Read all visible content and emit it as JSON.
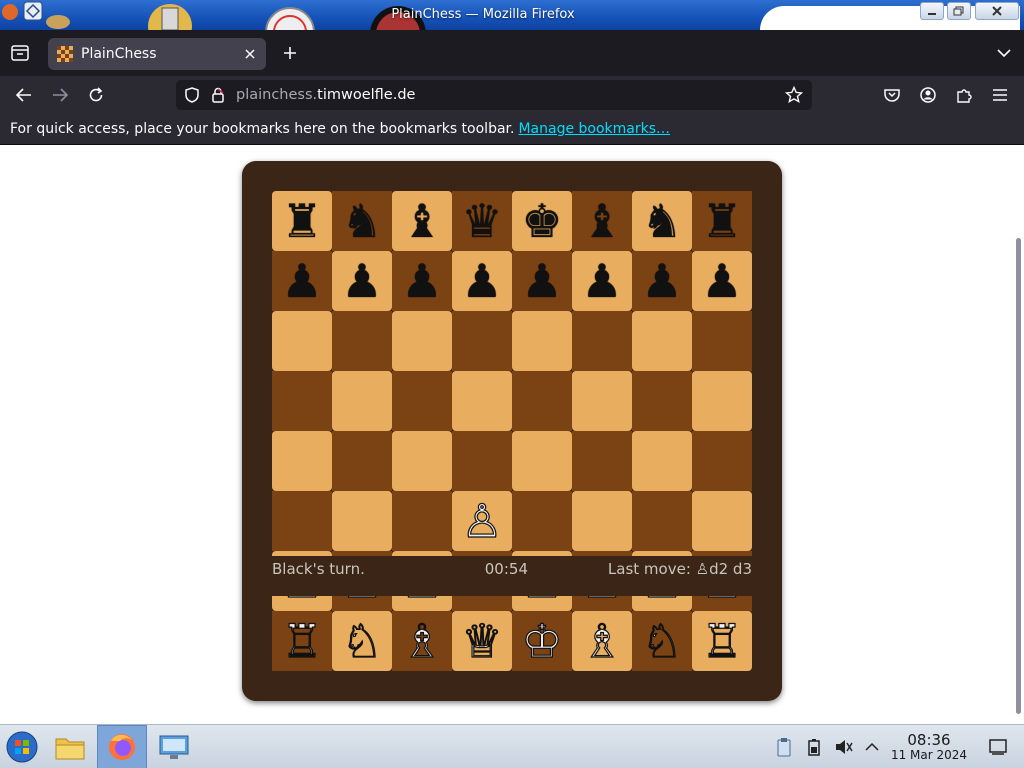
{
  "window": {
    "title": "PlainChess — Mozilla Firefox"
  },
  "browser": {
    "tab_title": "PlainChess",
    "url_subdomain": "plainchess.",
    "url_domain": "timwoelfle.de",
    "bookmarks_message": "For quick access, place your bookmarks here on the bookmarks toolbar.",
    "bookmarks_link": "Manage bookmarks…"
  },
  "game": {
    "board": [
      [
        "♜",
        "♞",
        "♝",
        "♛",
        "♚",
        "♝",
        "♞",
        "♜"
      ],
      [
        "♟",
        "♟",
        "♟",
        "♟",
        "♟",
        "♟",
        "♟",
        "♟"
      ],
      [
        "",
        "",
        "",
        "",
        "",
        "",
        "",
        ""
      ],
      [
        "",
        "",
        "",
        "",
        "",
        "",
        "",
        ""
      ],
      [
        "",
        "",
        "",
        "",
        "",
        "",
        "",
        ""
      ],
      [
        "",
        "",
        "",
        "♙",
        "",
        "",
        "",
        ""
      ],
      [
        "♙",
        "♙",
        "♙",
        "",
        "♙",
        "♙",
        "♙",
        "♙"
      ],
      [
        "♖",
        "♘",
        "♗",
        "♕",
        "♔",
        "♗",
        "♘",
        "♖"
      ]
    ],
    "turn_text": "Black's turn.",
    "timer": "00:54",
    "last_move_text": "Last move: ♙d2 d3"
  },
  "taskbar": {
    "clock_time": "08:36",
    "clock_date": "11 Mar 2024"
  },
  "colors": {
    "light_square": "#e8ad5e",
    "dark_square": "#7b4213",
    "board_frame": "#3a2516",
    "firefox_dark": "#1c1b22",
    "link": "#00ddff"
  }
}
